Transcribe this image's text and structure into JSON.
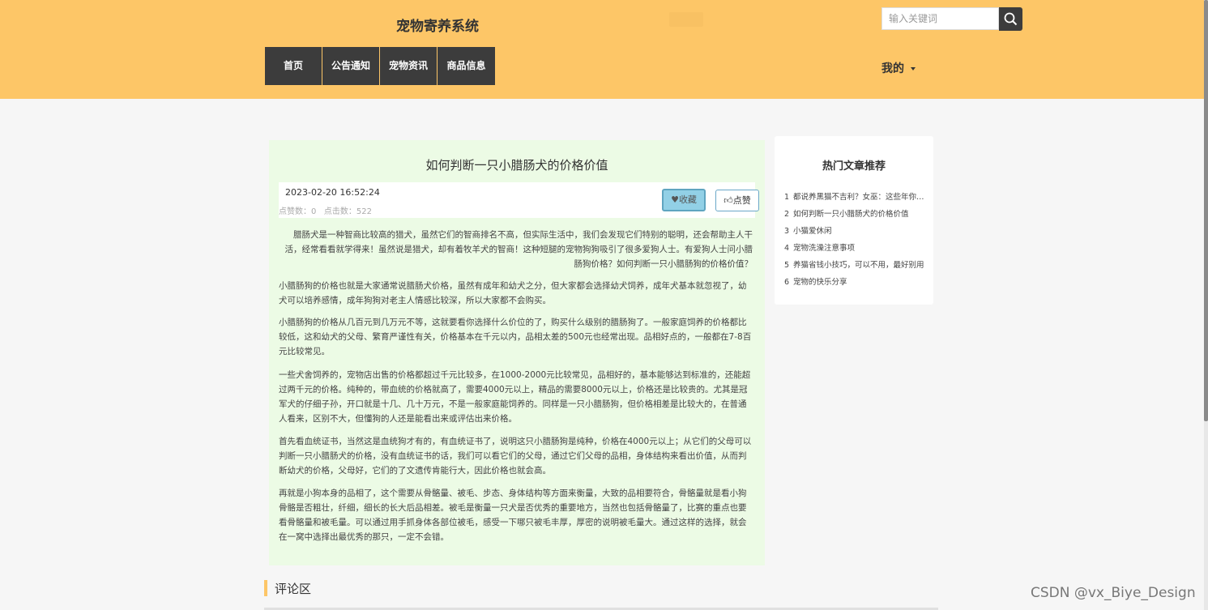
{
  "header": {
    "site_title": "宠物寄养系统",
    "search_placeholder": "输入关键词",
    "nav": [
      "首页",
      "公告通知",
      "宠物资讯",
      "商品信息"
    ],
    "user_menu": "我的"
  },
  "article": {
    "title": "如何判断一只小腊肠犬的价格价值",
    "date": "2023-02-20 16:52:24",
    "like_count_text": "点赞数：0",
    "click_count_text": "点击数：522",
    "favorite_label": "收藏",
    "like_label": "点赞",
    "paragraphs": [
      "腊肠犬是一种智商比较高的猎犬，虽然它们的智商排名不高，但实际生活中，我们会发现它们特别的聪明，还会帮助主人干活，经常看看就学得来！虽然说是猎犬，却有着牧羊犬的智商！这种短腿的宠物狗狗吸引了很多爱狗人士。有爱狗人士问小腊肠狗价格？如何判断一只小腊肠狗的价格价值？",
      "小腊肠狗的价格也就是大家通常说腊肠犬价格，虽然有成年和幼犬之分，但大家都会选择幼犬饲养，成年犬基本就忽视了，幼犬可以培养感情，成年狗狗对老主人情感比较深，所以大家都不会购买。",
      "小腊肠狗的价格从几百元到几万元不等，这就要看你选择什么价位的了，购买什么级别的腊肠狗了。一般家庭饲养的价格都比较低，这和幼犬的父母、繁育严谨性有关，价格基本在千元以内，品相太差的500元也经常出现。品相好点的，一般都在7-8百元比较常见。",
      "一些犬舍饲养的，宠物店出售的价格都超过千元比较多，在1000-2000元比较常见，品相好的，基本能够达到标准的，还能超过两千元的价格。纯种的，带血统的价格就高了，需要4000元以上，精品的需要8000元以上，价格还是比较贵的。尤其是冠军犬的仔细子孙，开口就是十几、几十万元，不是一般家庭能饲养的。同样是一只小腊肠狗，但价格相差是比较大的，在普通人看来，区别不大，但懂狗的人还是能看出来或评估出来价格。",
      "首先看血统证书，当然这是血统狗才有的，有血统证书了，说明这只小腊肠狗是纯种，价格在4000元以上；从它们的父母可以判断一只小腊肠犬的价格，没有血统证书的话，我们可以看它们的父母，通过它们父母的品相，身体结构来看出价值，从而判断幼犬的价格，父母好，它们的了文遗传肯能行大，因此价格也就会高。",
      "再就是小狗本身的品相了，这个需要从骨骼量、被毛、步态、身体结构等方面来衡量，大致的品相要符合，骨骼量就是看小狗骨骼是否粗壮，纤细，细长的长大后品相差。被毛是衡量一只犬是否优秀的重要地方，当然也包括骨骼量了，比赛的重点也要看骨骼量和被毛量。可以通过用手抓身体各部位被毛，感受一下哪只被毛丰厚，厚密的说明被毛量大。通过这样的选择，就会在一窝中选择出最优秀的那只，一定不会错。"
    ]
  },
  "sidebar": {
    "title": "热门文章推荐",
    "items": [
      {
        "num": "1",
        "text": "都说养黑猫不吉利？女巫：这些年你对它误会太深"
      },
      {
        "num": "2",
        "text": "如何判断一只小腊肠犬的价格价值"
      },
      {
        "num": "3",
        "text": "小猫爱休闲"
      },
      {
        "num": "4",
        "text": "宠物洗澡注意事项"
      },
      {
        "num": "5",
        "text": "养猫省钱小技巧，可以不用，最好别用"
      },
      {
        "num": "6",
        "text": "宠物的快乐分享"
      }
    ]
  },
  "comments": {
    "title": "评论区"
  },
  "watermark": "CSDN @vx_Biye_Design",
  "colors": {
    "header_bg": "#fdc667",
    "nav_bg": "#3c3c3c",
    "article_bg": "#ecfbe5"
  }
}
